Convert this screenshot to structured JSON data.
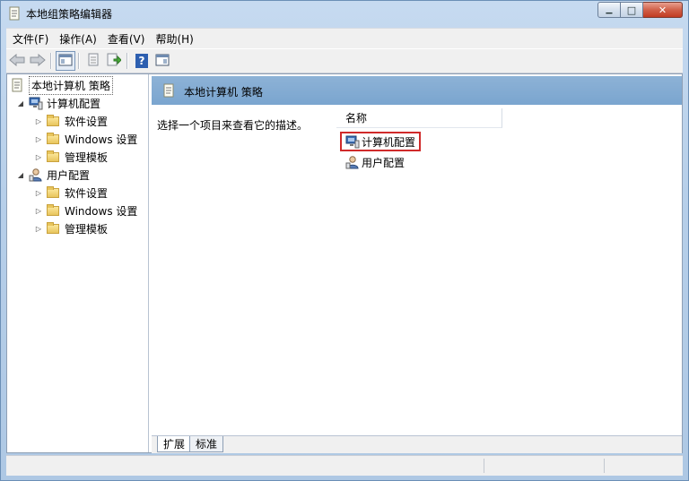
{
  "window": {
    "title": "本地组策略编辑器",
    "buttons": {
      "minimize": "▁",
      "maximize": "□",
      "close": "✕"
    }
  },
  "menu": [
    "文件(F)",
    "操作(A)",
    "查看(V)",
    "帮助(H)"
  ],
  "toolbar": {
    "icons": [
      "back-arrow-icon",
      "forward-arrow-icon",
      "show-hide-tree-icon",
      "properties-icon",
      "export-list-icon",
      "help-icon",
      "show-hide-action-pane-icon"
    ],
    "help_glyph": "?"
  },
  "tree": {
    "root": "本地计算机 策略",
    "computer": "计算机配置",
    "computer_children": [
      "软件设置",
      "Windows 设置",
      "管理模板"
    ],
    "user": "用户配置",
    "user_children": [
      "软件设置",
      "Windows 设置",
      "管理模板"
    ],
    "expanded_glyph": "◢",
    "collapsed_glyph": "▷"
  },
  "right": {
    "header": "本地计算机 策略",
    "description": "选择一个项目来查看它的描述。",
    "column_header": "名称",
    "items": [
      "计算机配置",
      "用户配置"
    ]
  },
  "tabs": [
    "扩展",
    "标准"
  ],
  "colors": {
    "header_blue": "#7aa5cf",
    "highlight_red": "#d02a2a",
    "window_frame": "#b7cfe9"
  }
}
